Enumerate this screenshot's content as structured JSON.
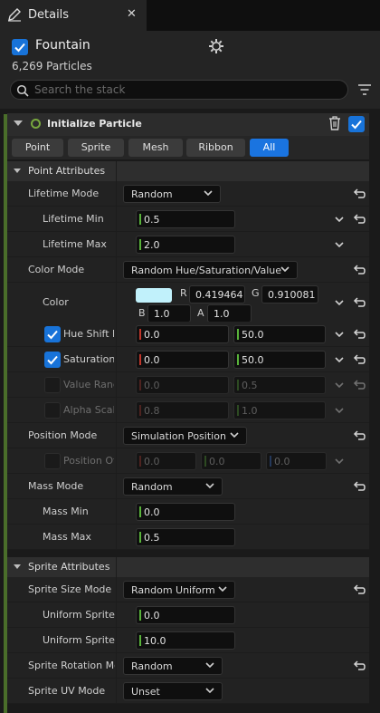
{
  "tab": {
    "title": "Details",
    "close_glyph": "✕"
  },
  "header": {
    "emitter_name": "Fountain",
    "emitter_enabled": true,
    "particle_count": "6,269 Particles",
    "search_placeholder": "Search the stack"
  },
  "module": {
    "title": "Initialize Particle",
    "enabled": true
  },
  "filters": [
    "Point",
    "Sprite",
    "Mesh",
    "Ribbon",
    "All"
  ],
  "active_filter": "All",
  "point_attributes": {
    "title": "Point Attributes",
    "lifetime_mode": {
      "label": "Lifetime Mode",
      "value": "Random"
    },
    "lifetime_min": {
      "label": "Lifetime Min",
      "value": "0.5"
    },
    "lifetime_max": {
      "label": "Lifetime Max",
      "value": "2.0"
    },
    "color_mode": {
      "label": "Color Mode",
      "value": "Random Hue/Saturation/Value"
    },
    "color": {
      "label": "Color",
      "swatch": "#c1f1fb",
      "r_label": "R",
      "r": "0.419464",
      "g_label": "G",
      "g": "0.910081",
      "b_label": "B",
      "b": "1.0",
      "a_label": "A",
      "a": "1.0"
    },
    "hue_shift": {
      "label": "Hue Shift R",
      "min": "0.0",
      "max": "50.0",
      "enabled": true
    },
    "saturation": {
      "label": "Saturation",
      "min": "0.0",
      "max": "50.0",
      "enabled": true
    },
    "value_range": {
      "label": "Value Range",
      "min": "0.0",
      "max": "0.5",
      "enabled": false
    },
    "alpha_scale": {
      "label": "Alpha Scale",
      "min": "0.8",
      "max": "1.0",
      "enabled": false
    },
    "position_mode": {
      "label": "Position Mode",
      "value": "Simulation Position"
    },
    "position_offset": {
      "label": "Position Offset",
      "x": "0.0",
      "y": "0.0",
      "z": "0.0",
      "enabled": false
    },
    "mass_mode": {
      "label": "Mass Mode",
      "value": "Random"
    },
    "mass_min": {
      "label": "Mass Min",
      "value": "0.0"
    },
    "mass_max": {
      "label": "Mass Max",
      "value": "0.5"
    }
  },
  "sprite_attributes": {
    "title": "Sprite Attributes",
    "sprite_size_mode": {
      "label": "Sprite Size Mode",
      "value": "Random Uniform"
    },
    "uniform_sprite_min": {
      "label": "Uniform Sprite Size Min",
      "value": "0.0"
    },
    "uniform_sprite_max": {
      "label": "Uniform Sprite Size Max",
      "value": "10.0"
    },
    "sprite_rotation_mode": {
      "label": "Sprite Rotation Mode",
      "value": "Random"
    },
    "sprite_uv_mode": {
      "label": "Sprite UV Mode",
      "value": "Unset"
    }
  },
  "colors": {
    "accent": "#1a74e0",
    "checkbox": "#1873d9",
    "module_ring": "#78a83e",
    "emitter_bar": "#4a6e2a"
  }
}
